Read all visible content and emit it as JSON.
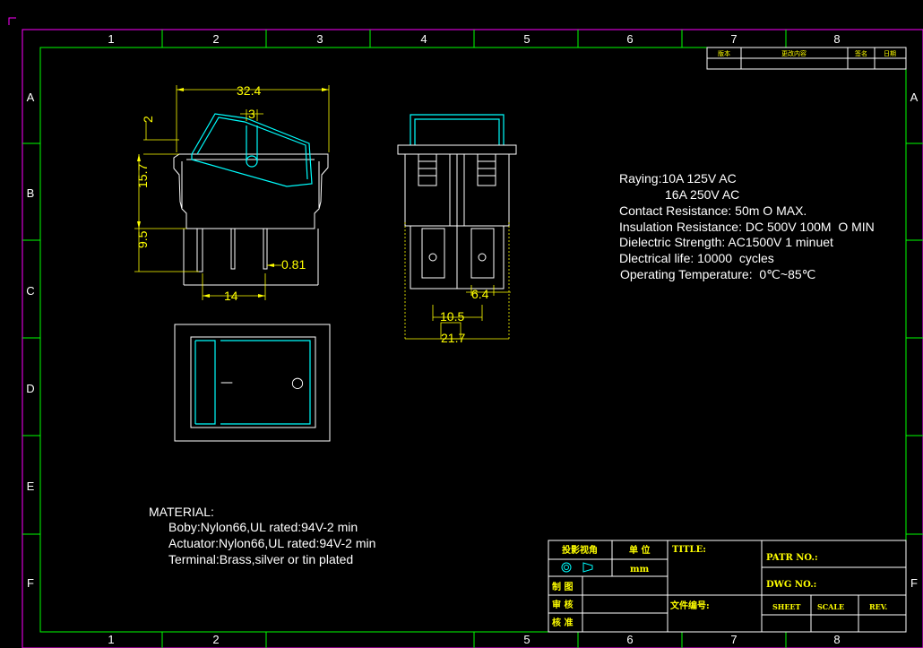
{
  "frame": {
    "col_labels": [
      "1",
      "2",
      "3",
      "4",
      "5",
      "6",
      "7",
      "8"
    ],
    "row_labels": [
      "A",
      "B",
      "C",
      "D",
      "E",
      "F"
    ],
    "bottom_col_labels": [
      "1",
      "2",
      "5",
      "6",
      "7",
      "8"
    ]
  },
  "revision_table": {
    "headers": [
      "版本",
      "更改内容",
      "签名",
      "日期"
    ]
  },
  "dimensions": {
    "d_width": "32.4",
    "d_actuator": "3",
    "d_top": "2",
    "d_height": "15.7",
    "d_pin_len": "9.5",
    "d_pin_thick": "0.81",
    "d_pin_pitch": "14",
    "d_terminal": "6.4",
    "d_pin_spacing": "10.5",
    "d_overall": "21.7"
  },
  "front_view": {
    "off_mark": "—",
    "on_mark": "○"
  },
  "specs": {
    "rating_1": "Raying:10A 125V AC",
    "rating_2": "16A 250V AC",
    "contact": "Contact Resistance: 50m O MAX.",
    "insulation": "Insulation Resistance: DC 500V 100M  O MIN",
    "dielectric": "Dielectric Strength: AC1500V 1 minuet",
    "life": "Dlectrical life: 10000  cycles",
    "temperature": "Operating Temperature:  0℃~85℃"
  },
  "material": {
    "title": "MATERIAL:",
    "body": "Boby:Nylon66,UL rated:94V-2 min",
    "actuator": "Actuator:Nylon66,UL rated:94V-2 min",
    "terminal": "Terminal:Brass,silver or tin plated"
  },
  "title_block": {
    "projection": "投影视角",
    "unit_label": "单 位",
    "unit_value": "mm",
    "drawn": "制 图",
    "checked": "审 核",
    "approved": "核 准",
    "title": "TITLE:",
    "file_no": "文件编号:",
    "part_no": "PATR NO.:",
    "dwg_no": "DWG NO.:",
    "sheet": "SHEET",
    "scale": "SCALE",
    "rev": "REV."
  },
  "colors": {
    "frame": "#ff00ff",
    "border": "#00ff00",
    "outline": "#ffffff",
    "dimension": "#ffff00",
    "actuator": "#00ffff",
    "title_text": "#ffff00",
    "background": "#000000"
  }
}
